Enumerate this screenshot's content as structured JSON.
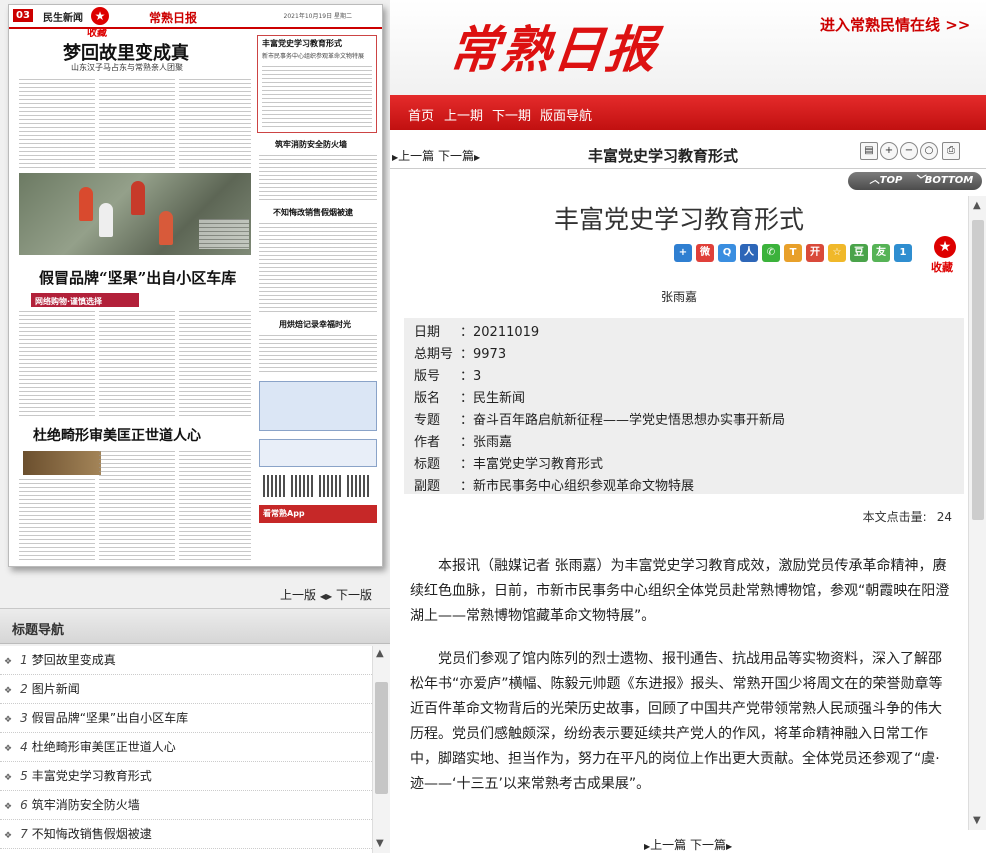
{
  "thumbnail": {
    "page_number": "03",
    "page_name": "民生新闻",
    "favorite_label": "收藏",
    "masthead": "常熟日报",
    "date_line": "2021年10月19日 星期二",
    "headline_1": "梦回故里变成真",
    "subhead_1": "山东汉子马占东与常熟亲人团聚",
    "headline_2": "假冒品牌“坚果”出自小区车库",
    "stripe_2": "网络购物·谨慎选择",
    "headline_3": "杜绝畸形审美匡正世道人心",
    "side_1": "丰富党史学习教育形式",
    "side_1_sub": "新市民事务中心组织参观革命文物特展",
    "side_2": "筑牢消防安全防火墙",
    "side_3": "不知悔改销售假烟被逮",
    "side_4": "用烘焙记录幸福时光",
    "app_bar": "看常熟App"
  },
  "page_nav": {
    "prev": "上一版",
    "next": "下一版"
  },
  "title_nav": {
    "header": "标题导航",
    "items": [
      {
        "num": "1",
        "label": "梦回故里变成真"
      },
      {
        "num": "2",
        "label": "图片新闻"
      },
      {
        "num": "3",
        "label": "假冒品牌“坚果”出自小区车库"
      },
      {
        "num": "4",
        "label": "杜绝畸形审美匡正世道人心"
      },
      {
        "num": "5",
        "label": "丰富党史学习教育形式"
      },
      {
        "num": "6",
        "label": "筑牢消防安全防火墙"
      },
      {
        "num": "7",
        "label": "不知悔改销售假烟被逮"
      }
    ]
  },
  "banner": {
    "masthead": "常熟日报",
    "link": "进入常熟民情在线 >>"
  },
  "menu": {
    "home": "首页",
    "prev_issue": "上一期",
    "next_issue": "下一期",
    "layout_nav": "版面导航"
  },
  "toolbar": {
    "prev": "上一篇",
    "next": "下一篇",
    "title": "丰富党史学习教育形式"
  },
  "scroll_buttons": {
    "top": "TOP",
    "bottom": "BOTTOM"
  },
  "article": {
    "title": "丰富党史学习教育形式",
    "favorite_label": "收藏",
    "author": "张雨嘉",
    "meta": [
      {
        "key": "日期",
        "value": "20211019"
      },
      {
        "key": "总期号",
        "value": "9973"
      },
      {
        "key": "版号",
        "value": "3"
      },
      {
        "key": "版名",
        "value": "民生新闻"
      },
      {
        "key": "专题",
        "value": "奋斗百年路启航新征程——学党史悟思想办实事开新局"
      },
      {
        "key": "作者",
        "value": "张雨嘉"
      },
      {
        "key": "标题",
        "value": "丰富党史学习教育形式"
      },
      {
        "key": "副题",
        "value": "新市民事务中心组织参观革命文物特展"
      }
    ],
    "click_label": "本文点击量:",
    "click_count": "24",
    "paragraphs": [
      "本报讯（融媒记者 张雨嘉）为丰富党史学习教育成效，激励党员传承革命精神，赓续红色血脉，日前，市新市民事务中心组织全体党员赴常熟博物馆，参观“朝霞映在阳澄湖上——常熟博物馆藏革命文物特展”。",
      "党员们参观了馆内陈列的烈士遗物、报刊通告、抗战用品等实物资料，深入了解邵松年书“亦爱庐”横幅、陈毅元帅题《东进报》报头、常熟开国少将周文在的荣誉勋章等近百件革命文物背后的光荣历史故事，回顾了中国共产党带领常熟人民顽强斗争的伟大历程。党员们感触颇深，纷纷表示要延续共产党人的作风，将革命精神融入日常工作中，脚踏实地、担当作为，努力在平凡的岗位上作出更大贡献。全体党员还参观了“虞·迹——‘十三五’以来常熟考古成果展”。"
    ]
  },
  "bottom_nav": {
    "prev": "上一篇",
    "next": "下一篇"
  },
  "colors": {
    "brand_red": "#d11111",
    "menu_red": "#c11010"
  }
}
